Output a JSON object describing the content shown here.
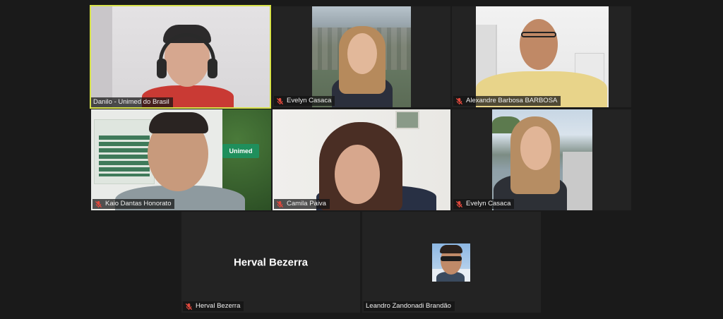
{
  "participants": [
    {
      "name": "Danilo - Unimed do Brasil",
      "muted": false,
      "active_speaker": true
    },
    {
      "name": "Evelyn Casaca",
      "muted": true
    },
    {
      "name": "Alexandre Barbosa BARBOSA",
      "muted": true
    },
    {
      "name": "Kaio Dantas Honorato",
      "muted": true
    },
    {
      "name": "Camila Paiva",
      "muted": true
    },
    {
      "name": "Evelyn Casaca",
      "muted": true
    },
    {
      "name": "Herval Bezerra",
      "muted": true,
      "video_off_label": "Herval Bezerra"
    },
    {
      "name": "Leandro Zandonadi Brandão",
      "muted": false
    }
  ],
  "wall_sign": "Unimed",
  "colors": {
    "active_border": "#d7e24a",
    "muted_icon": "#e0483c",
    "background": "#1a1a1a"
  }
}
